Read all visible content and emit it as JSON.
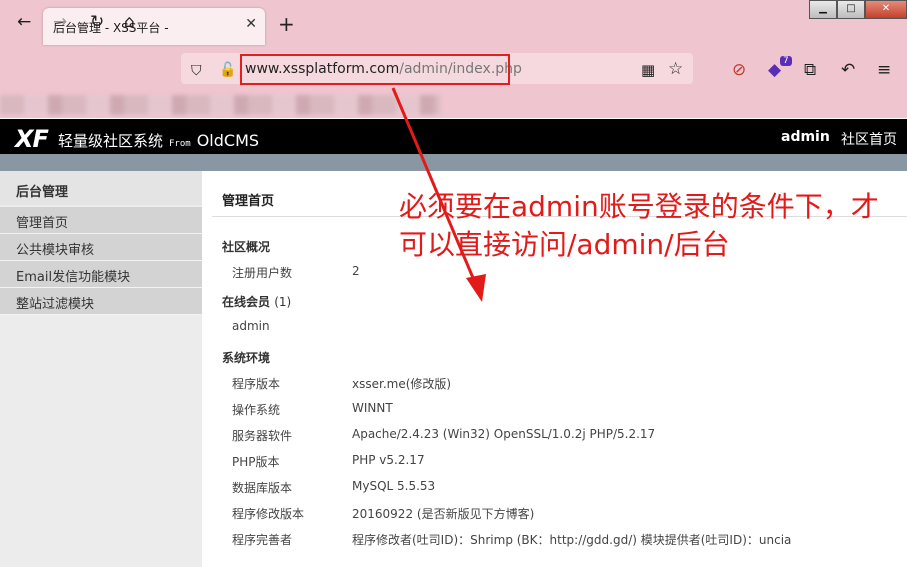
{
  "browser": {
    "tab_title": "后台管理 - XSS平台 -",
    "tab_close": "✕",
    "new_tab": "+",
    "url_host": "www.xssplatform.com",
    "url_path": "/admin/index.php",
    "extension_badge": "7",
    "window_buttons": {
      "minimize": "▁",
      "maximize": "□",
      "close": "✕"
    }
  },
  "app": {
    "logo": "XF",
    "title": "轻量级社区系统",
    "from": "From",
    "cms": "OldCMS",
    "user": "admin",
    "home_link": "社区首页"
  },
  "sidebar": {
    "title": "后台管理",
    "items": [
      "管理首页",
      "公共模块审核",
      "Email发信功能模块",
      "整站过滤模块"
    ]
  },
  "main": {
    "title": "管理首页",
    "overview": {
      "heading": "社区概况",
      "rows": [
        {
          "label": "注册用户数",
          "value": "2"
        }
      ]
    },
    "online": {
      "heading": "在线会员",
      "count": "(1)",
      "users": [
        "admin"
      ]
    },
    "env": {
      "heading": "系统环境",
      "rows": [
        {
          "label": "程序版本",
          "value": "xsser.me(修改版)"
        },
        {
          "label": "操作系统",
          "value": "WINNT"
        },
        {
          "label": "服务器软件",
          "value": "Apache/2.4.23 (Win32) OpenSSL/1.0.2j PHP/5.2.17"
        },
        {
          "label": "PHP版本",
          "value": "PHP v5.2.17"
        },
        {
          "label": "数据库版本",
          "value": "MySQL 5.5.53"
        },
        {
          "label": "程序修改版本",
          "value": "20160922 (是否新版见下方博客)"
        },
        {
          "label": "程序完善者",
          "value": "程序修改者(吐司ID)：Shrimp (BK：http://gdd.gd/) 模块提供者(吐司ID)：uncia"
        }
      ]
    }
  },
  "annotation": "必须要在admin账号登录的条件下，才可以直接访问/admin/后台",
  "colors": {
    "annotation": "#e31a1a",
    "chrome": "#efc5cf",
    "appbar": "#000000"
  }
}
